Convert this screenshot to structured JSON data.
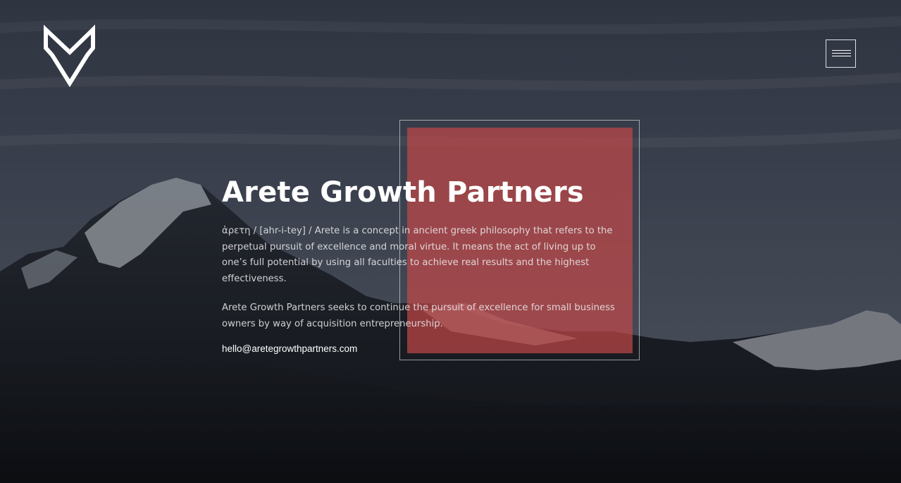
{
  "header": {
    "logo_icon": "mv-chevron-logo-icon",
    "menu_icon": "hamburger-menu-icon"
  },
  "hero": {
    "title": "Arete Growth Partners",
    "definition": "ἀρετη / [ahr-i-tey] / Arete is a concept in ancient greek philosophy that refers to the perpetual pursuit of excellence and moral virtue. It means the act of living up to one’s full potential by using all faculties to achieve real results and the highest effectiveness.",
    "mission": "Arete Growth Partners seeks to continue the pursuit of excellence for small business owners by way of acquisition entrepreneurship.",
    "email": "hello@aretegrowthpartners.com"
  },
  "colors": {
    "accent_square": "#c84848",
    "text": "#ffffff",
    "sky": "#3f4755"
  }
}
